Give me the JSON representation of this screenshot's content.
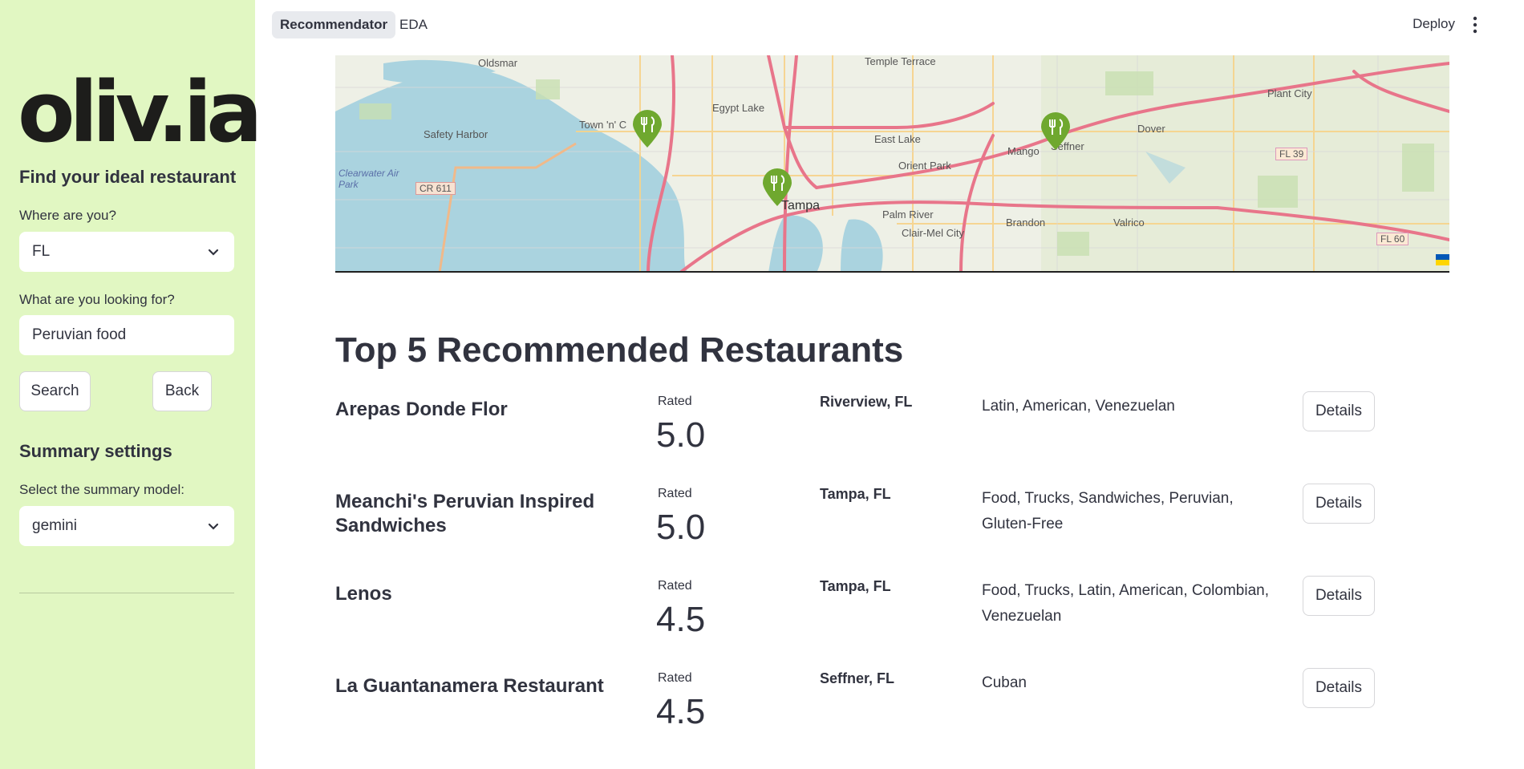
{
  "sidebar": {
    "logo": "oliv.ia",
    "find_heading": "Find your ideal restaurant",
    "where_label": "Where are you?",
    "where_value": "FL",
    "what_label": "What are you looking for?",
    "what_value": "Peruvian food",
    "search_label": "Search",
    "back_label": "Back",
    "summary_heading": "Summary settings",
    "model_label": "Select the summary model:",
    "model_value": "gemini"
  },
  "header": {
    "tabs": [
      {
        "label": "Recommendator",
        "active": true
      },
      {
        "label": "EDA",
        "active": false
      }
    ],
    "deploy_label": "Deploy"
  },
  "map": {
    "labels": {
      "oldsmar": "Oldsmar",
      "temple_terrace": "Temple Terrace",
      "plant_city": "Plant City",
      "egypt_lake": "Egypt Lake",
      "safety_harbor": "Safety Harbor",
      "town_n_country": "Town 'n' C",
      "east_lake": "East Lake",
      "dover": "Dover",
      "mango": "Mango",
      "seffner": "Seffner",
      "orient_park": "Orient Park",
      "clearwater_air_park": "Clearwater Air Park",
      "cr611": "CR 611",
      "tampa": "Tampa",
      "palm_river": "Palm River",
      "clair_mel_city": "Clair-Mel City",
      "brandon": "Brandon",
      "valrico": "Valrico",
      "fl39": "FL 39",
      "fl60": "FL 60"
    },
    "pin_icon": "fork-knife-icon"
  },
  "results": {
    "heading": "Top 5 Recommended Restaurants",
    "rated_label": "Rated",
    "details_label": "Details",
    "items": [
      {
        "name": "Arepas Donde Flor",
        "rating": "5.0",
        "location": "Riverview, FL",
        "categories": "Latin, American, Venezuelan"
      },
      {
        "name": "Meanchi's Peruvian Inspired Sandwiches",
        "rating": "5.0",
        "location": "Tampa, FL",
        "categories": "Food, Trucks, Sandwiches, Peruvian, Gluten-Free"
      },
      {
        "name": "Lenos",
        "rating": "4.5",
        "location": "Tampa, FL",
        "categories": "Food, Trucks, Latin, American, Colombian, Venezuelan"
      },
      {
        "name": "La Guantanamera Restaurant",
        "rating": "4.5",
        "location": "Seffner, FL",
        "categories": "Cuban"
      }
    ]
  },
  "colors": {
    "sidebar_bg": "#e1f7c2",
    "pin_green": "#6fa82f",
    "water": "#aad3df",
    "road_major": "#e8758a"
  }
}
